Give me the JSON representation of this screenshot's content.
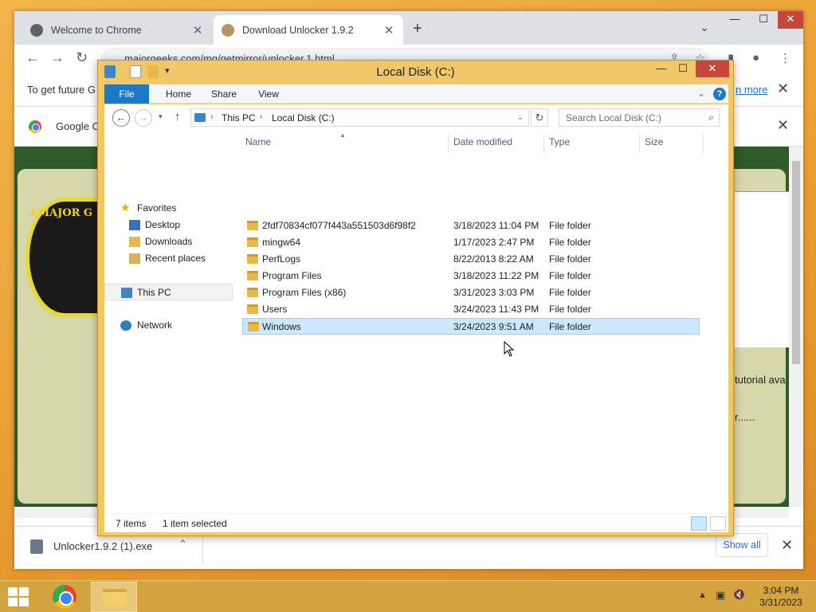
{
  "chrome": {
    "tabs": [
      {
        "label": "Welcome to Chrome",
        "close": "✕"
      },
      {
        "label": "Download Unlocker 1.9.2",
        "close": "✕"
      }
    ],
    "new_tab": "+",
    "tab_search": "⌄",
    "window": {
      "minimize": "—",
      "maximize": "☐",
      "close": "✕"
    },
    "nav": {
      "back": "←",
      "forward": "→",
      "reload": "↻"
    },
    "url": "majorgeeks.com/mg/getmirror/unlocker,1.html",
    "toolbar_icons": {
      "share": "⇪",
      "star": "☆",
      "sidebar": "▮",
      "profile": "●",
      "menu": "⋮"
    },
    "infobar": {
      "text": "To get future G",
      "link": "n more",
      "close": "✕"
    },
    "infobar2": {
      "text": "Google C",
      "close": "✕"
    },
    "page": {
      "logo_text": "★MAJOR G",
      "text1": "tutorial ava",
      "text2": "r......"
    },
    "download": {
      "filename": "Unlocker1.9.2 (1).exe",
      "chevron": "⌃",
      "show_all": "Show all",
      "close": "✕"
    }
  },
  "explorer": {
    "title": "Local Disk (C:)",
    "quick_access_dropdown": "▾",
    "window": {
      "minimize": "—",
      "maximize": "☐",
      "close": "✕"
    },
    "ribbon_tabs": [
      "File",
      "Home",
      "Share",
      "View"
    ],
    "ribbon_expand": "⌄",
    "help": "?",
    "nav_buttons": {
      "back": "←",
      "forward": "→",
      "recent": "▾",
      "up": "↑"
    },
    "breadcrumb": [
      "This PC",
      "Local Disk (C:)"
    ],
    "crumb_sep": "›",
    "path_dropdown": "⌄",
    "refresh": "↻",
    "search_placeholder": "Search Local Disk (C:)",
    "search_icon": "⌕",
    "nav_pane": {
      "favorites": "Favorites",
      "desktop": "Desktop",
      "downloads": "Downloads",
      "recent_places": "Recent places",
      "this_pc": "This PC",
      "network": "Network"
    },
    "columns": [
      "Name",
      "Date modified",
      "Type",
      "Size"
    ],
    "sort_indicator": "▲",
    "rows": [
      {
        "name": "2fdf70834cf077f443a551503d6f98f2",
        "date": "3/18/2023 11:04 PM",
        "type": "File folder"
      },
      {
        "name": "mingw64",
        "date": "1/17/2023 2:47 PM",
        "type": "File folder"
      },
      {
        "name": "PerfLogs",
        "date": "8/22/2013 8:22 AM",
        "type": "File folder"
      },
      {
        "name": "Program Files",
        "date": "3/18/2023 11:22 PM",
        "type": "File folder"
      },
      {
        "name": "Program Files (x86)",
        "date": "3/31/2023 3:03 PM",
        "type": "File folder"
      },
      {
        "name": "Users",
        "date": "3/24/2023 11:43 PM",
        "type": "File folder"
      },
      {
        "name": "Windows",
        "date": "3/24/2023 9:51 AM",
        "type": "File folder"
      }
    ],
    "selected_row": 6,
    "status": {
      "items": "7 items",
      "selected": "1 item selected"
    }
  },
  "taskbar": {
    "tray": {
      "chevron": "▲",
      "network": "▣",
      "volume": "🔇"
    },
    "time": "3:04 PM",
    "date": "3/31/2023"
  },
  "colors": {
    "ribbon_file": "#1979ca",
    "selection": "#cce8ff",
    "close_red": "#c7473a",
    "explorer_frame": "#f0c868"
  }
}
